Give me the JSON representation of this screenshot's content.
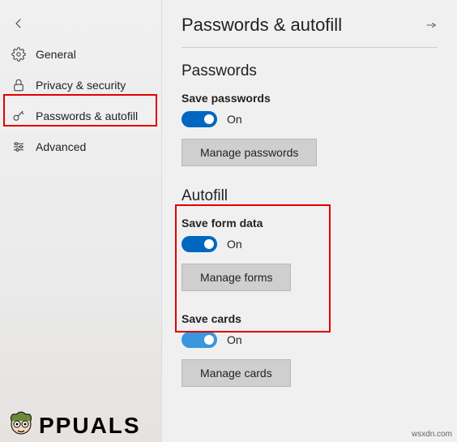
{
  "sidebar": {
    "items": [
      {
        "label": "General"
      },
      {
        "label": "Privacy & security"
      },
      {
        "label": "Passwords & autofill"
      },
      {
        "label": "Advanced"
      }
    ]
  },
  "header": {
    "title": "Passwords & autofill"
  },
  "sections": {
    "passwords": {
      "title": "Passwords",
      "save_label": "Save passwords",
      "toggle_state": "On",
      "manage_label": "Manage passwords"
    },
    "autofill": {
      "title": "Autofill",
      "save_label": "Save form data",
      "toggle_state": "On",
      "manage_label": "Manage forms"
    },
    "cards": {
      "save_label": "Save cards",
      "toggle_state": "On",
      "manage_label": "Manage cards"
    }
  },
  "watermark": {
    "logo_text": "PPUALS",
    "source": "wsxdn.com"
  }
}
